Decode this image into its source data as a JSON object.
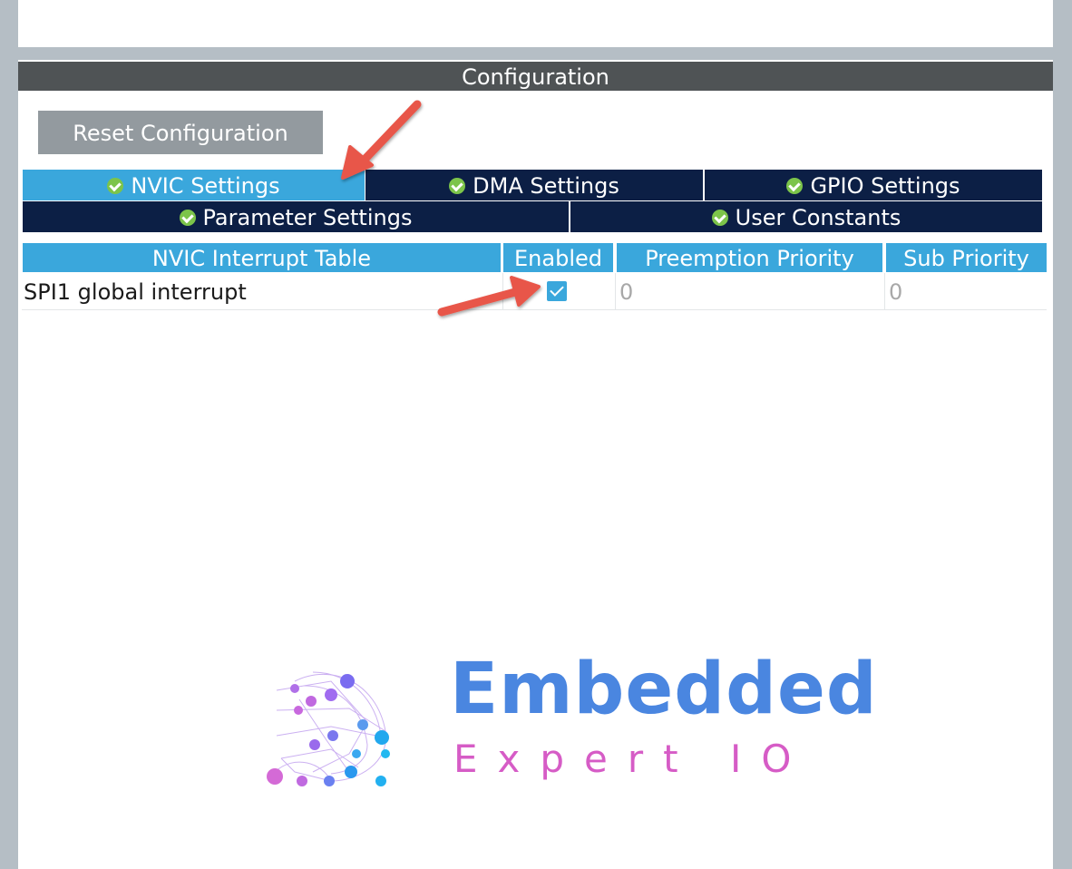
{
  "header": {
    "title": "Configuration"
  },
  "toolbar": {
    "reset_label": "Reset Configuration"
  },
  "tabs": [
    {
      "label": "NVIC Settings",
      "active": true
    },
    {
      "label": "DMA Settings",
      "active": false
    },
    {
      "label": "GPIO Settings",
      "active": false
    },
    {
      "label": "Parameter Settings",
      "active": false
    },
    {
      "label": "User Constants",
      "active": false
    }
  ],
  "table": {
    "columns": [
      "NVIC Interrupt Table",
      "Enabled",
      "Preemption Priority",
      "Sub Priority"
    ],
    "rows": [
      {
        "name": "SPI1 global interrupt",
        "enabled": true,
        "preemption_priority": "0",
        "sub_priority": "0"
      }
    ]
  },
  "logo": {
    "title": "Embedded",
    "subtitle": "Expert IO"
  },
  "colors": {
    "tab_active": "#3aa7dc",
    "tab_inactive": "#0c1f45",
    "header_bg": "#4f5355",
    "annotation_arrow": "#e8574a",
    "logo_primary": "#4a86e0",
    "logo_secondary": "#d65cc6"
  }
}
